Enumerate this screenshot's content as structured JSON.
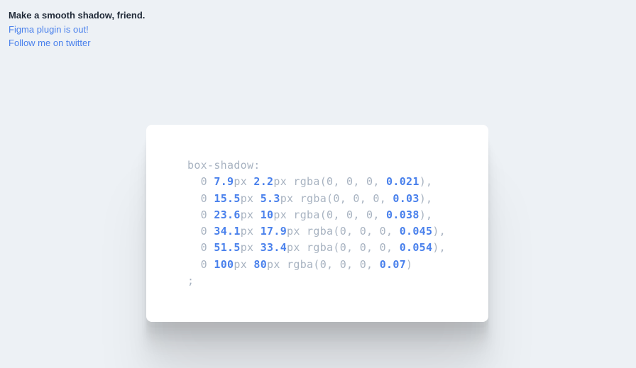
{
  "header": {
    "title": "Make a smooth shadow, friend.",
    "link_figma": "Figma plugin is out!",
    "link_twitter": "Follow me on twitter"
  },
  "code": {
    "property": "box-shadow:",
    "terminator": ";",
    "shadows": [
      {
        "x": "0",
        "y": "7.9",
        "blur": "2.2",
        "alpha": "0.021"
      },
      {
        "x": "0",
        "y": "15.5",
        "blur": "5.3",
        "alpha": "0.03"
      },
      {
        "x": "0",
        "y": "23.6",
        "blur": "10",
        "alpha": "0.038"
      },
      {
        "x": "0",
        "y": "34.1",
        "blur": "17.9",
        "alpha": "0.045"
      },
      {
        "x": "0",
        "y": "51.5",
        "blur": "33.4",
        "alpha": "0.054"
      },
      {
        "x": "0",
        "y": "100",
        "blur": "80",
        "alpha": "0.07"
      }
    ]
  }
}
